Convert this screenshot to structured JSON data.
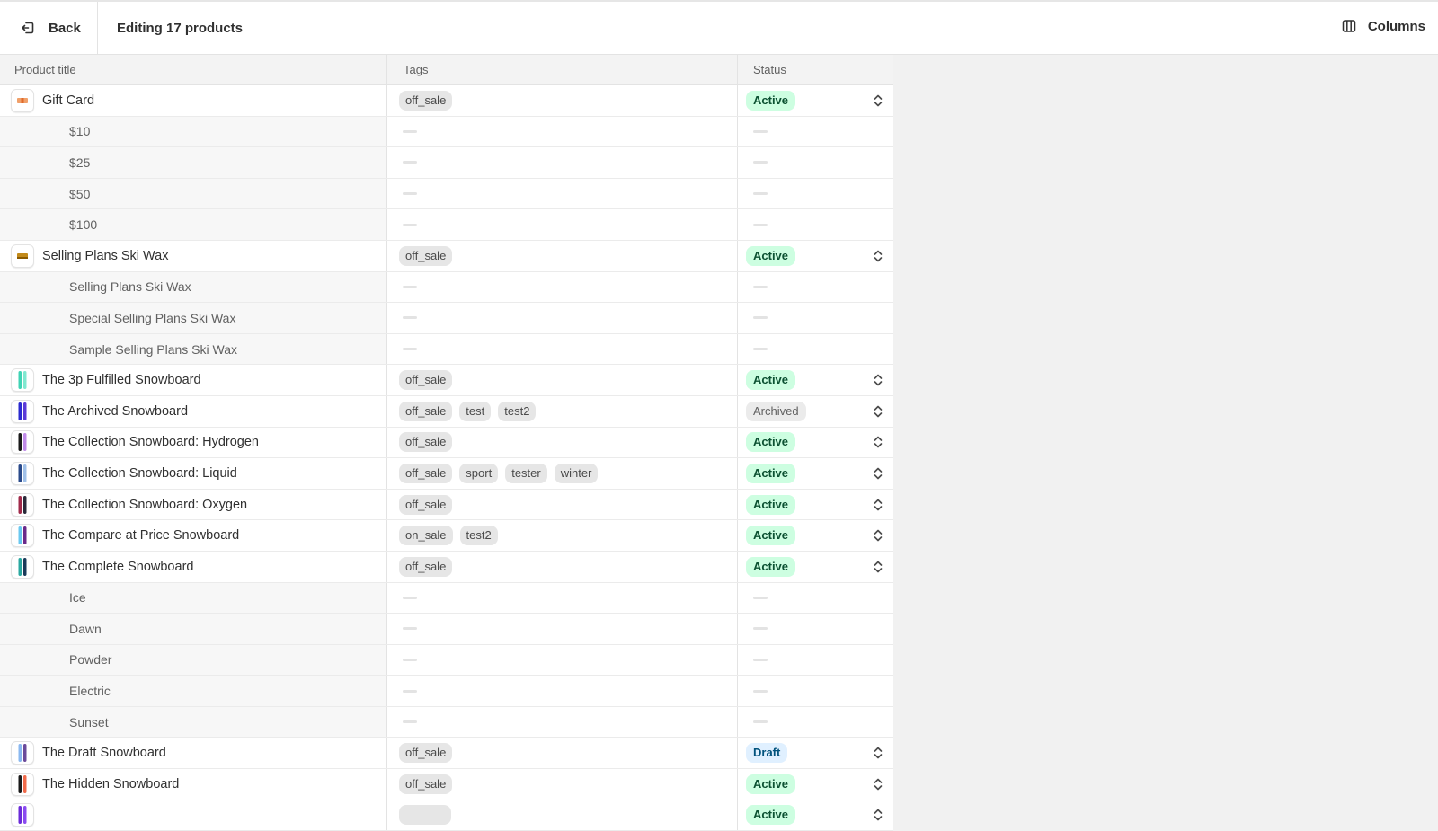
{
  "topbar": {
    "back_label": "Back",
    "title": "Editing 17 products",
    "columns_label": "Columns"
  },
  "table": {
    "headers": [
      "Product title",
      "Tags",
      "Status"
    ],
    "rows": [
      {
        "type": "product",
        "title": "Gift Card",
        "thumb_colors": [
          "#f0a06a",
          "#e06a2a"
        ],
        "thumb_kind": "card",
        "tags": [
          "off_sale"
        ],
        "status": "Active"
      },
      {
        "type": "variant",
        "title": "$10"
      },
      {
        "type": "variant",
        "title": "$25"
      },
      {
        "type": "variant",
        "title": "$50"
      },
      {
        "type": "variant",
        "title": "$100"
      },
      {
        "type": "product",
        "title": "Selling Plans Ski Wax",
        "thumb_colors": [
          "#c28a1a",
          "#8a5a00"
        ],
        "thumb_kind": "wax",
        "tags": [
          "off_sale"
        ],
        "status": "Active"
      },
      {
        "type": "variant",
        "title": "Selling Plans Ski Wax"
      },
      {
        "type": "variant",
        "title": "Special Selling Plans Ski Wax"
      },
      {
        "type": "variant",
        "title": "Sample Selling Plans Ski Wax"
      },
      {
        "type": "product",
        "title": "The 3p Fulfilled Snowboard",
        "thumb_colors": [
          "#3fd3b4",
          "#7fe8d0"
        ],
        "thumb_kind": "board",
        "tags": [
          "off_sale"
        ],
        "status": "Active"
      },
      {
        "type": "product",
        "title": "The Archived Snowboard",
        "thumb_colors": [
          "#2a2acf",
          "#5a3ad8"
        ],
        "thumb_kind": "board",
        "tags": [
          "off_sale",
          "test",
          "test2"
        ],
        "status": "Archived"
      },
      {
        "type": "product",
        "title": "The Collection Snowboard: Hydrogen",
        "thumb_colors": [
          "#1a1a1a",
          "#c08ae8"
        ],
        "thumb_kind": "board",
        "tags": [
          "off_sale"
        ],
        "status": "Active"
      },
      {
        "type": "product",
        "title": "The Collection Snowboard: Liquid",
        "thumb_colors": [
          "#2a4a8a",
          "#a0c0e8"
        ],
        "thumb_kind": "board",
        "tags": [
          "off_sale",
          "sport",
          "tester",
          "winter"
        ],
        "status": "Active"
      },
      {
        "type": "product",
        "title": "The Collection Snowboard: Oxygen",
        "thumb_colors": [
          "#a02a4a",
          "#2a2a3a"
        ],
        "thumb_kind": "board",
        "tags": [
          "off_sale"
        ],
        "status": "Active"
      },
      {
        "type": "product",
        "title": "The Compare at Price Snowboard",
        "thumb_colors": [
          "#6ac8f0",
          "#6a2a8a"
        ],
        "thumb_kind": "board",
        "tags": [
          "on_sale",
          "test2"
        ],
        "status": "Active"
      },
      {
        "type": "product",
        "title": "The Complete Snowboard",
        "thumb_colors": [
          "#2aa8a0",
          "#1a3a5a"
        ],
        "thumb_kind": "board",
        "tags": [
          "off_sale"
        ],
        "status": "Active"
      },
      {
        "type": "variant",
        "title": "Ice"
      },
      {
        "type": "variant",
        "title": "Dawn"
      },
      {
        "type": "variant",
        "title": "Powder"
      },
      {
        "type": "variant",
        "title": "Electric"
      },
      {
        "type": "variant",
        "title": "Sunset"
      },
      {
        "type": "product",
        "title": "The Draft Snowboard",
        "thumb_colors": [
          "#8ab8f0",
          "#6a4a9a"
        ],
        "thumb_kind": "board",
        "tags": [
          "off_sale"
        ],
        "status": "Draft"
      },
      {
        "type": "product",
        "title": "The Hidden Snowboard",
        "thumb_colors": [
          "#1a1a1a",
          "#f06a4a"
        ],
        "thumb_kind": "board",
        "tags": [
          "off_sale"
        ],
        "status": "Active"
      },
      {
        "type": "product",
        "title": "",
        "thumb_colors": [
          "#6a2ad8",
          "#8a4af0"
        ],
        "thumb_kind": "board",
        "tags": [
          ""
        ],
        "status": "Active"
      }
    ]
  }
}
